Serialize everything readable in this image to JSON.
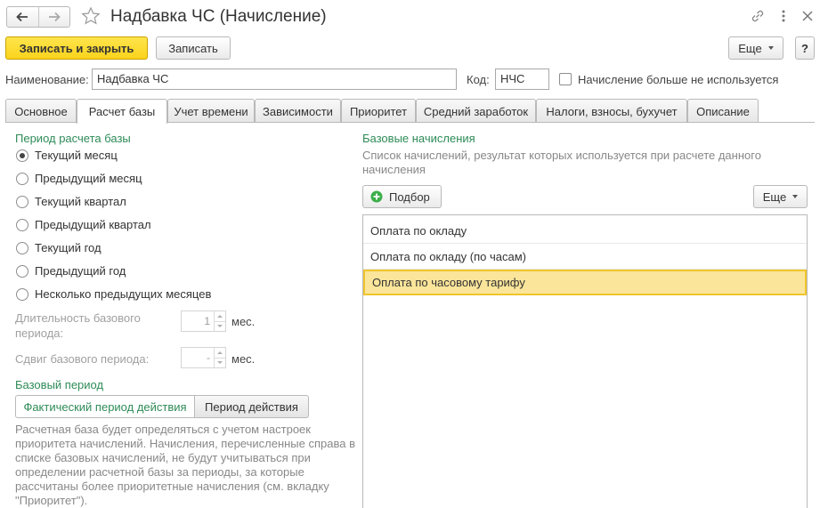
{
  "window": {
    "title": "Надбавка ЧС (Начисление)"
  },
  "toolbar": {
    "save_close_label": "Записать и закрыть",
    "save_label": "Записать",
    "more_label": "Еще"
  },
  "fields": {
    "name_label": "Наименование:",
    "name_value": "Надбавка ЧС",
    "code_label": "Код:",
    "code_value": "НЧС",
    "unused_label": "Начисление больше не используется",
    "unused_checked": false
  },
  "tabs": [
    {
      "label": "Основное"
    },
    {
      "label": "Расчет базы",
      "active": true
    },
    {
      "label": "Учет времени"
    },
    {
      "label": "Зависимости"
    },
    {
      "label": "Приоритет"
    },
    {
      "label": "Средний заработок"
    },
    {
      "label": "Налоги, взносы, бухучет"
    },
    {
      "label": "Описание"
    }
  ],
  "period": {
    "title": "Период расчета базы",
    "options": [
      {
        "label": "Текущий месяц",
        "selected": true
      },
      {
        "label": "Предыдущий месяц"
      },
      {
        "label": "Текущий квартал"
      },
      {
        "label": "Предыдущий квартал"
      },
      {
        "label": "Текущий год"
      },
      {
        "label": "Предыдущий год"
      },
      {
        "label": "Несколько предыдущих месяцев"
      }
    ],
    "duration_label_1": "Длительность базового",
    "duration_label_2": "периода:",
    "duration_value": "1",
    "duration_unit": "мес.",
    "shift_label": "Сдвиг базового периода:",
    "shift_value": "-",
    "shift_unit": "мес."
  },
  "base_period": {
    "title": "Базовый период",
    "actual_label": "Фактический период действия",
    "action_label": "Период действия",
    "note_lines": [
      "Расчетная база будет определяться с учетом настроек",
      "приоритета начислений. Начисления, перечисленные справа в",
      "списке базовых начислений, не будут учитываться при",
      "определении расчетной базы за периоды, за которые",
      "рассчитаны более приоритетные начисления (см. вкладку",
      "\"Приоритет\")."
    ]
  },
  "base_accruals": {
    "title": "Базовые начисления",
    "desc_line_1": "Список начислений, результат которых используется при расчете данного",
    "desc_line_2": "начисления",
    "pick_label": "Подбор",
    "more_label": "Еще",
    "items": [
      {
        "label": "Оплата по окладу"
      },
      {
        "label": "Оплата по окладу (по часам)"
      },
      {
        "label": "Оплата по часовому тарифу",
        "selected": true
      }
    ]
  },
  "colors": {
    "accent_green": "#2e8b57",
    "primary_yellow": "#fad31c",
    "selection": "#fbe59a"
  }
}
